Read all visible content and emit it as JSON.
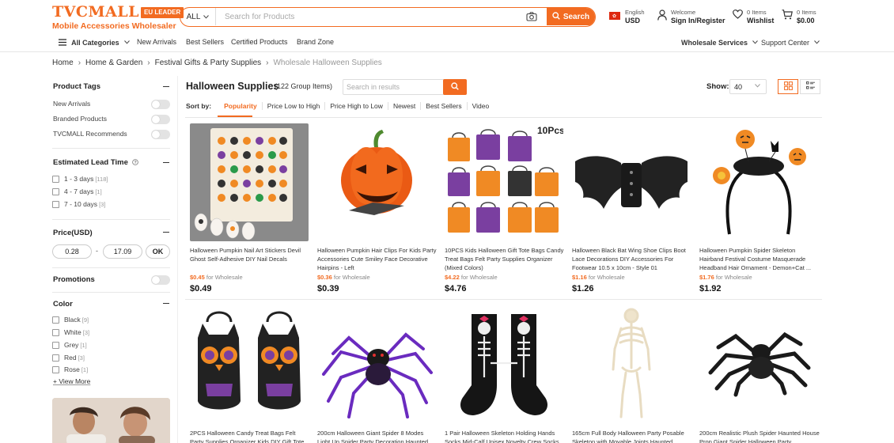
{
  "logo": {
    "word": "TVCMALL",
    "badge": "EU LEADER",
    "tagline": "Mobile Accessories Wholesaler"
  },
  "search": {
    "category": "ALL",
    "placeholder": "Search for Products",
    "button": "Search"
  },
  "header": {
    "language": "English",
    "currency": "USD",
    "welcome": "Welcome",
    "signin": "Sign In/Register",
    "wishlist_count": "0 Items",
    "wishlist_label": "Wishlist",
    "cart_count": "0 Items",
    "cart_total": "$0.00"
  },
  "nav": {
    "all_categories": "All Categories",
    "items": [
      "New Arrivals",
      "Best Sellers",
      "Certified Products",
      "Brand Zone"
    ],
    "right": [
      "Wholesale Services",
      "Support Center"
    ]
  },
  "breadcrumb": [
    "Home",
    "Home & Garden",
    "Festival Gifts & Party Supplies",
    "Wholesale Halloween Supplies"
  ],
  "sidebar": {
    "product_tags": {
      "title": "Product Tags",
      "items": [
        "New Arrivals",
        "Branded Products",
        "TVCMALL Recommends"
      ]
    },
    "lead_time": {
      "title": "Estimated Lead Time",
      "items": [
        {
          "label": "1 - 3 days",
          "count": "[118]"
        },
        {
          "label": "4 - 7 days",
          "count": "[1]"
        },
        {
          "label": "7 - 10 days",
          "count": "[3]"
        }
      ]
    },
    "price": {
      "title": "Price(USD)",
      "min": "0.28",
      "sep": "-",
      "max": "17.09",
      "ok": "OK"
    },
    "promotions": {
      "title": "Promotions"
    },
    "color": {
      "title": "Color",
      "items": [
        {
          "label": "Black",
          "count": "[9]"
        },
        {
          "label": "White",
          "count": "[3]"
        },
        {
          "label": "Grey",
          "count": "[1]"
        },
        {
          "label": "Red",
          "count": "[3]"
        },
        {
          "label": "Rose",
          "count": "[1]"
        }
      ],
      "more": "+ View More"
    }
  },
  "listing": {
    "title": "Halloween Supplies",
    "count": "(122  Group Items)",
    "search_placeholder": "Search in results",
    "show_label": "Show:",
    "show_value": "40",
    "sort_label": "Sort by:",
    "sort_options": [
      "Popularity",
      "Price Low to High",
      "Price High to Low",
      "Newest",
      "Best Sellers",
      "Video"
    ]
  },
  "products": [
    {
      "name": "Halloween Pumpkin Nail Art Stickers Devil Ghost Self-Adhesive DIY Nail Decals",
      "wholesale": "$0.45",
      "wholesale_label": "for Wholesale",
      "price": "$0.49",
      "icon": "nail-stickers"
    },
    {
      "name": "Halloween Pumpkin Hair Clips For Kids Party Accessories Cute Smiley Face Decorative Hairpins - Left",
      "wholesale": "$0.36",
      "wholesale_label": "for Wholesale",
      "price": "$0.39",
      "icon": "pumpkin-clip"
    },
    {
      "name": "10PCS Kids Halloween Gift Tote Bags Candy Treat Bags Felt Party Supplies Organizer (Mixed Colors)",
      "wholesale": "$4.22",
      "wholesale_label": "for Wholesale",
      "price": "$4.76",
      "icon": "tote-bags",
      "img_text": "10Pcs"
    },
    {
      "name": "Halloween Black Bat Wing Shoe Clips Boot Lace Decorations DIY Accessories For Footwear 10.5 x 10cm - Style 01",
      "wholesale": "$1.16",
      "wholesale_label": "for Wholesale",
      "price": "$1.26",
      "icon": "bat-wings"
    },
    {
      "name": "Halloween Pumpkin Spider Skeleton Hairband Festival Costume Masquerade Headband Hair Ornament - Demon+Cat ...",
      "wholesale": "$1.76",
      "wholesale_label": "for Wholesale",
      "price": "$1.92",
      "icon": "headband"
    },
    {
      "name": "2PCS Halloween Candy Treat Bags Felt Party Supplies Organizer Kids DIY Gift Tote",
      "icon": "owl-bags"
    },
    {
      "name": "200cm Halloween Giant Spider 8 Modes Light Up Spider Party Decoration Haunted",
      "icon": "light-spider"
    },
    {
      "name": "1 Pair Halloween Skeleton Holding Hands Socks Mid-Calf Unisex Novelty Crew Socks",
      "icon": "skeleton-socks"
    },
    {
      "name": "165cm Full Body Halloween Party Posable Skeleton with Movable Joints Haunted",
      "icon": "skeleton"
    },
    {
      "name": "200cm Realistic Plush Spider Haunted House Prop Giant Spider Halloween Party",
      "icon": "plush-spider"
    }
  ]
}
